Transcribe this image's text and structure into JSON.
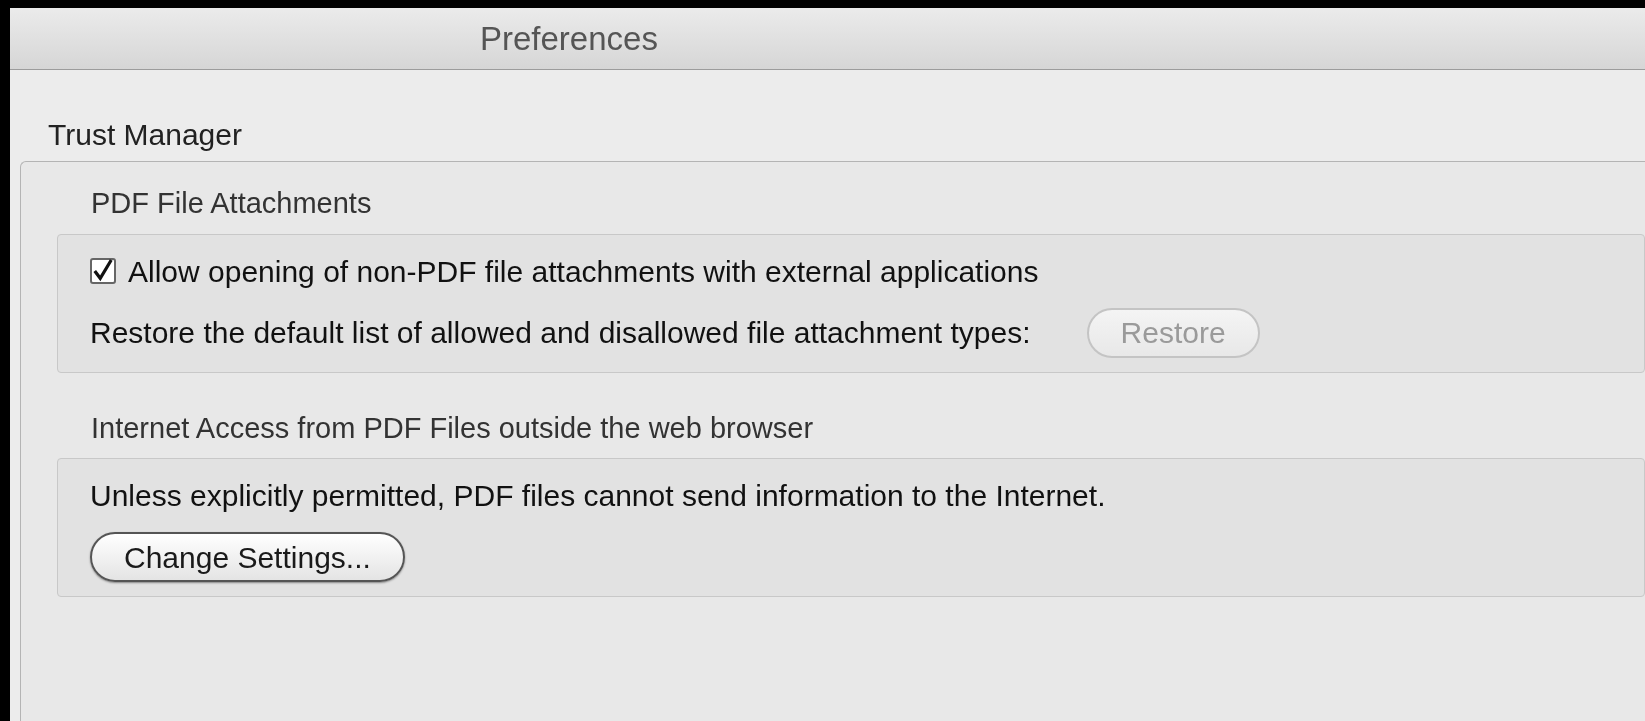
{
  "window": {
    "title": "Preferences"
  },
  "section": {
    "title": "Trust Manager",
    "groups": [
      {
        "title": "PDF File Attachments",
        "checkbox": {
          "label": "Allow opening of non-PDF file attachments with external applications",
          "checked": true
        },
        "row": {
          "label": "Restore the default list of allowed and disallowed file attachment types:",
          "button": {
            "label": "Restore",
            "disabled": true
          }
        }
      },
      {
        "title": "Internet Access from PDF Files outside the web browser",
        "text": "Unless explicitly permitted, PDF files cannot send information to the Internet.",
        "button": {
          "label": "Change Settings...",
          "disabled": false
        }
      }
    ]
  }
}
